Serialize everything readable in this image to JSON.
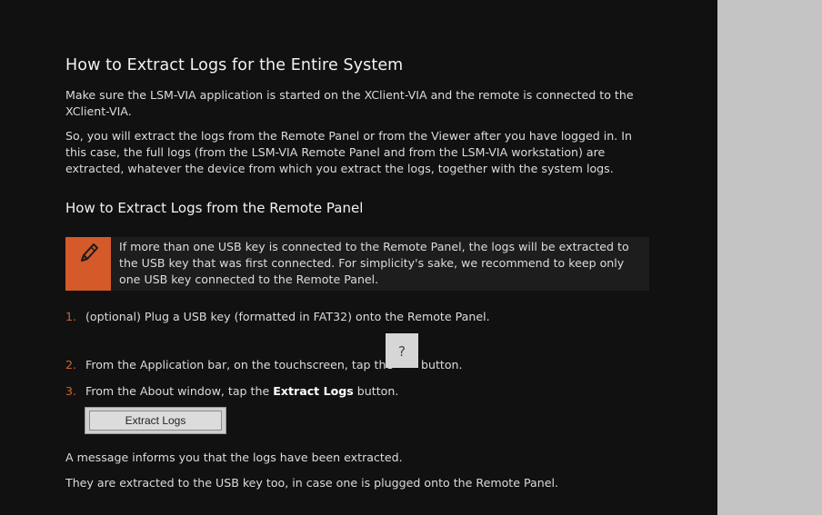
{
  "section1": {
    "title": "How to Extract Logs for the Entire System",
    "para1": "Make sure the LSM-VIA application is started on the XClient-VIA and the remote is connected to the XClient-VIA.",
    "para2": "So, you will extract the logs from the Remote Panel or from the Viewer after you have logged in. In this case, the full logs (from the LSM-VIA Remote Panel and from the LSM-VIA workstation) are extracted, whatever the device from which you extract the logs, together with the system logs."
  },
  "section2": {
    "title": "How to Extract Logs from the Remote Panel",
    "note": "If more than one USB key is connected to the Remote Panel, the logs will be extracted to the USB key that was first connected. For simplicity's sake, we recommend to keep only one USB key connected to the Remote Panel.",
    "note_icon": "pencil-icon",
    "steps": [
      {
        "num": "1.",
        "text": "(optional) Plug a USB key (formatted in FAT32) onto the Remote Panel."
      },
      {
        "num": "2.",
        "text_before": "From the Application bar, on the touchscreen, tap the",
        "button": "?",
        "text_after": "button."
      },
      {
        "num": "3.",
        "text_before": "From the About window, tap the",
        "bold": "Extract Logs",
        "text_after": "button."
      }
    ],
    "extract_button_label": "Extract Logs",
    "after1": "A message informs you that the logs have been extracted.",
    "after2": "They are extracted to the USB key too, in case one is plugged onto the Remote Panel."
  },
  "colors": {
    "accent": "#d45a2a",
    "background": "#111112",
    "side_pane": "#c4c4c4"
  }
}
